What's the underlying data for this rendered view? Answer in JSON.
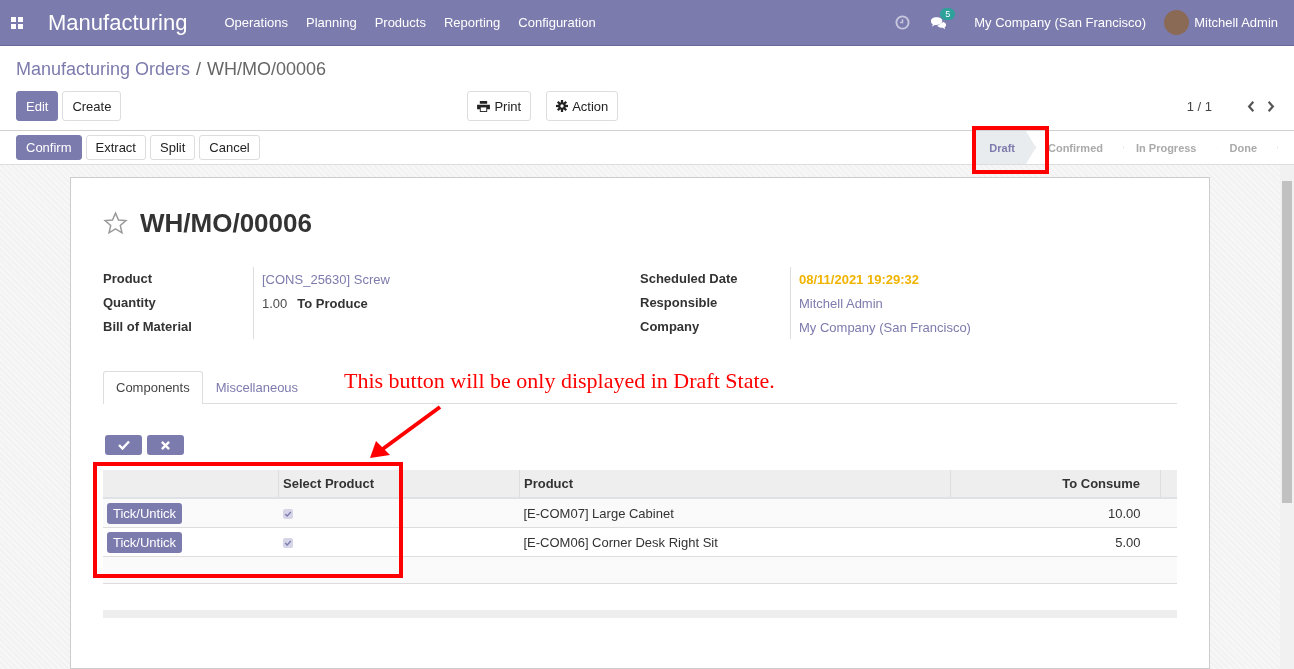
{
  "navbar": {
    "app_name": "Manufacturing",
    "menu": [
      "Operations",
      "Planning",
      "Products",
      "Reporting",
      "Configuration"
    ],
    "messages_count": "5",
    "company": "My Company (San Francisco)",
    "user": "Mitchell Admin"
  },
  "breadcrumb": {
    "parent": "Manufacturing Orders",
    "separator": "/",
    "current": "WH/MO/00006"
  },
  "main_buttons": [
    {
      "label": "Edit",
      "kind": "primary"
    },
    {
      "label": "Create",
      "kind": "secondary"
    }
  ],
  "tool_buttons": [
    {
      "label": "Print",
      "kind": "print"
    },
    {
      "label": "Action",
      "kind": "gear"
    }
  ],
  "pager": "1 / 1",
  "header_buttons": [
    {
      "label": "Confirm",
      "kind": "primary"
    },
    {
      "label": "Extract",
      "kind": "secondary"
    },
    {
      "label": "Split",
      "kind": "secondary"
    },
    {
      "label": "Cancel",
      "kind": "secondary"
    }
  ],
  "stages": [
    {
      "label": "Draft",
      "selected": true
    },
    {
      "label": "Confirmed",
      "selected": false
    },
    {
      "label": "In Progress",
      "selected": false
    },
    {
      "label": "Done",
      "selected": false
    }
  ],
  "record": {
    "title": "WH/MO/00006",
    "starred": false
  },
  "fields_left": [
    {
      "label": "Product",
      "value": "[CONS_25630] Screw",
      "kind": "link"
    },
    {
      "label": "Quantity",
      "value": "1.00",
      "unit": "To Produce",
      "kind": "quantity"
    },
    {
      "label": "Bill of Material",
      "kind": "empty"
    }
  ],
  "fields_right": [
    {
      "label": "Scheduled Date",
      "value": "08/11/2021 19:29:32",
      "kind": "date"
    },
    {
      "label": "Responsible",
      "value": "Mitchell Admin",
      "kind": "link"
    },
    {
      "label": "Company",
      "value": "My Company (San Francisco)",
      "kind": "link"
    }
  ],
  "tabs": [
    {
      "label": "Components",
      "selected": true
    },
    {
      "label": "Miscellaneous",
      "selected": false
    }
  ],
  "annotation": "This button will be only displayed in Draft State.",
  "table": {
    "columns": [
      "Select Product",
      "Product",
      "To Consume"
    ],
    "rows": [
      {
        "action": "Tick/Untick",
        "checked": true,
        "product": "[E-COM07] Large Cabinet",
        "to_consume": "10.00"
      },
      {
        "action": "Tick/Untick",
        "checked": true,
        "product": "[E-COM06] Corner Desk Right Sit",
        "to_consume": "5.00"
      }
    ]
  }
}
